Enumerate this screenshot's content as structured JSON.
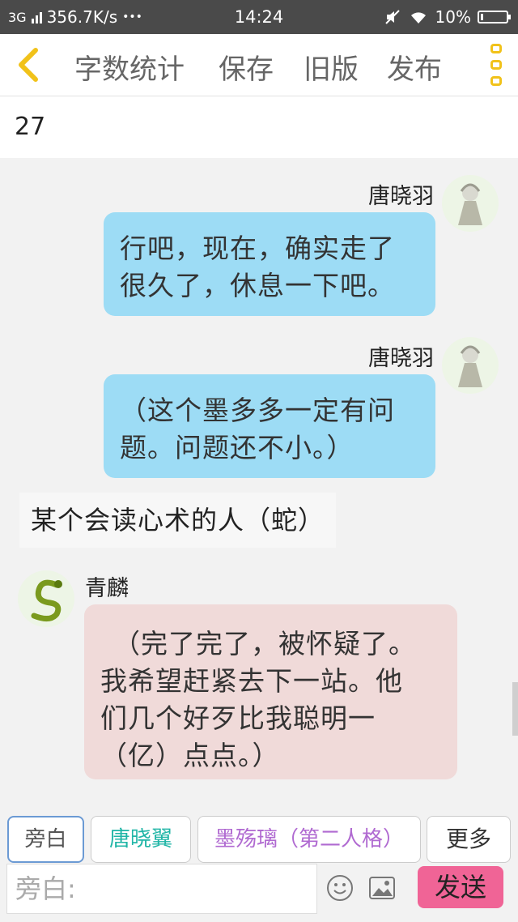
{
  "status_bar": {
    "network": "3G",
    "speed": "356.7K/s",
    "more": "•••",
    "time": "14:24",
    "battery": "10%",
    "battery_level": 0.1
  },
  "toolbar": {
    "items": [
      "字数统计",
      "保存",
      "旧版",
      "发布"
    ]
  },
  "word_count": "27",
  "messages": [
    {
      "speaker": "唐晓羽",
      "text": [
        "行吧，现在，确实走了",
        "很久了，休息一下吧。"
      ]
    },
    {
      "speaker": "唐晓羽",
      "text": [
        "（这个墨多多一定有问",
        "题。问题还不小。）"
      ]
    },
    {
      "narration": "某个会读心术的人（蛇）"
    },
    {
      "speaker": "青麟",
      "text": [
        "（完了完了，被怀疑了。",
        "我希望赶紧去下一站。他",
        "们几个好歹比我聪明一",
        "（亿）点点。）"
      ]
    }
  ],
  "role_buttons": [
    "旁白",
    "唐晓翼",
    "墨殇璃（第二人格）",
    "更多"
  ],
  "role_colors": {
    "default": "#555555",
    "tang": "#1fb5a6",
    "mo": "#b06ad1"
  },
  "input": {
    "placeholder": "旁白:"
  },
  "send_label": "发送",
  "icons": {
    "emoji": "smiley-icon",
    "image": "image-icon",
    "back": "back-chevron-icon",
    "more": "more-icon"
  }
}
